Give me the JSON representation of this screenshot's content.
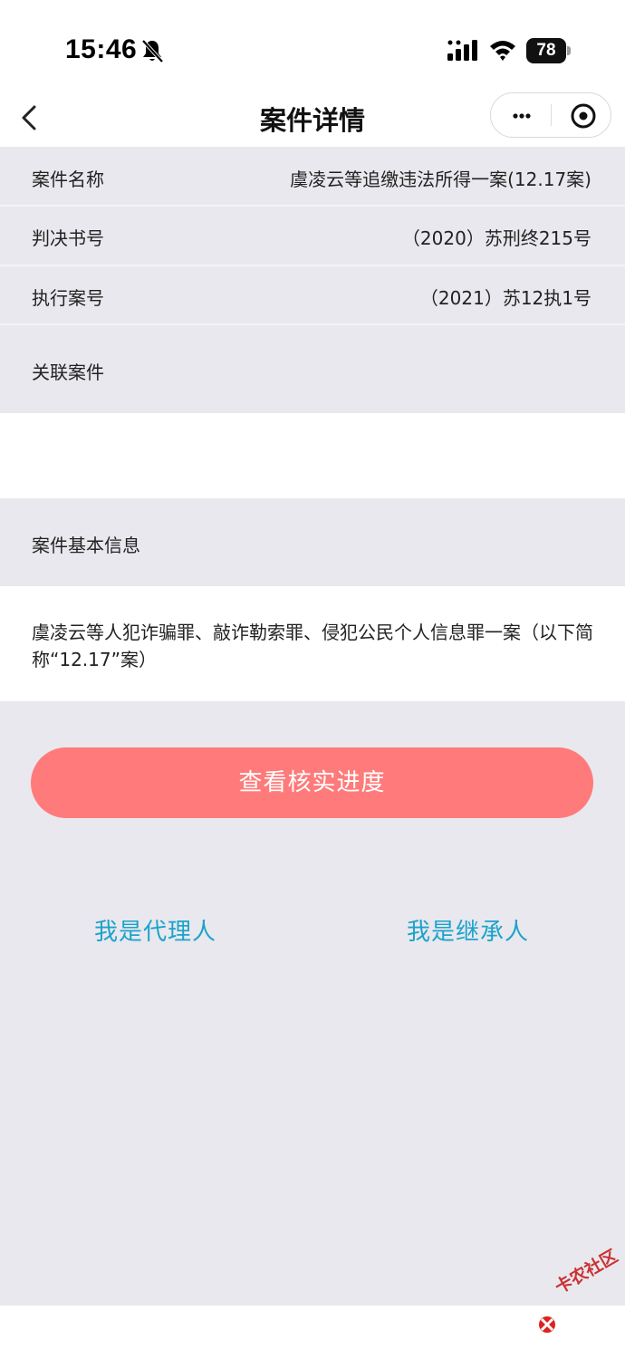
{
  "status_bar": {
    "time": "15:46",
    "battery": "78",
    "icons": [
      "bell-slash-icon",
      "signal-icon",
      "wifi-icon",
      "battery-icon"
    ]
  },
  "nav": {
    "title": "案件详情",
    "back_icon": "chevron-left-icon",
    "more_icon": "more-dots-icon",
    "close_icon": "target-circle-icon"
  },
  "case": {
    "name_label": "案件名称",
    "name_value": "虞凌云等追缴违法所得一案(12.17案)",
    "judgment_label": "判决书号",
    "judgment_value": "（2020）苏刑终215号",
    "execution_label": "执行案号",
    "execution_value": "（2021）苏12执1号",
    "related_label": "关联案件"
  },
  "basic_info": {
    "title": "案件基本信息",
    "description": "虞凌云等人犯诈骗罪、敲诈勒索罪、侵犯公民个人信息罪一案（以下简称“12.17”案）"
  },
  "actions": {
    "primary_label": "查看核实进度",
    "agent_link": "我是代理人",
    "heir_link": "我是继承人"
  },
  "colors": {
    "primary_button": "#ff7a7a",
    "link": "#1aa3cc",
    "background": "#e9e8ee"
  },
  "watermark": {
    "text": "卡农社区"
  }
}
